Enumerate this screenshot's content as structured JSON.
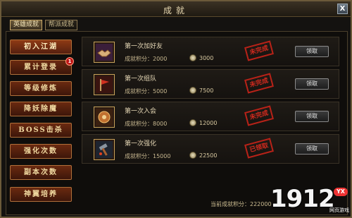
{
  "window": {
    "title": "成就",
    "close_label": "X"
  },
  "tabs": [
    {
      "label": "英雄成就",
      "active": true
    },
    {
      "label": "帮派成就",
      "active": false
    }
  ],
  "menu": [
    {
      "label": "初入江湖",
      "active": true,
      "badge": ""
    },
    {
      "label": "累计登录",
      "active": false,
      "badge": "1"
    },
    {
      "label": "等级修炼",
      "active": false,
      "badge": ""
    },
    {
      "label": "降妖除魔",
      "active": false,
      "badge": ""
    },
    {
      "label": "BOSS击杀",
      "active": false,
      "badge": ""
    },
    {
      "label": "强化次数",
      "active": false,
      "badge": ""
    },
    {
      "label": "副本次数",
      "active": false,
      "badge": ""
    },
    {
      "label": "神翼培养",
      "active": false,
      "badge": ""
    }
  ],
  "achievements": [
    {
      "title": "第一次加好友",
      "points_label": "成就积分：2000",
      "coin_value": "3000",
      "status": "未完成",
      "button": "领取",
      "icon": "handshake-icon"
    },
    {
      "title": "第一次组队",
      "points_label": "成就积分：5000",
      "coin_value": "7500",
      "status": "未完成",
      "button": "领取",
      "icon": "team-flag-icon"
    },
    {
      "title": "第一次入会",
      "points_label": "成就积分：8000",
      "coin_value": "12000",
      "status": "未完成",
      "button": "领取",
      "icon": "guild-emblem-icon"
    },
    {
      "title": "第一次强化",
      "points_label": "成就积分：15000",
      "coin_value": "22500",
      "status": "已领取",
      "button": "领取",
      "icon": "forge-hammer-icon"
    }
  ],
  "footer": {
    "total_points_label": "当前成就积分：",
    "total_points_value": "222000"
  },
  "logo": {
    "number": "1912",
    "badge": "YX",
    "subtitle": "网页游戏"
  },
  "colors": {
    "accent": "#b0703a",
    "stamp": "#d12a1e",
    "title": "#e8d8b0"
  }
}
